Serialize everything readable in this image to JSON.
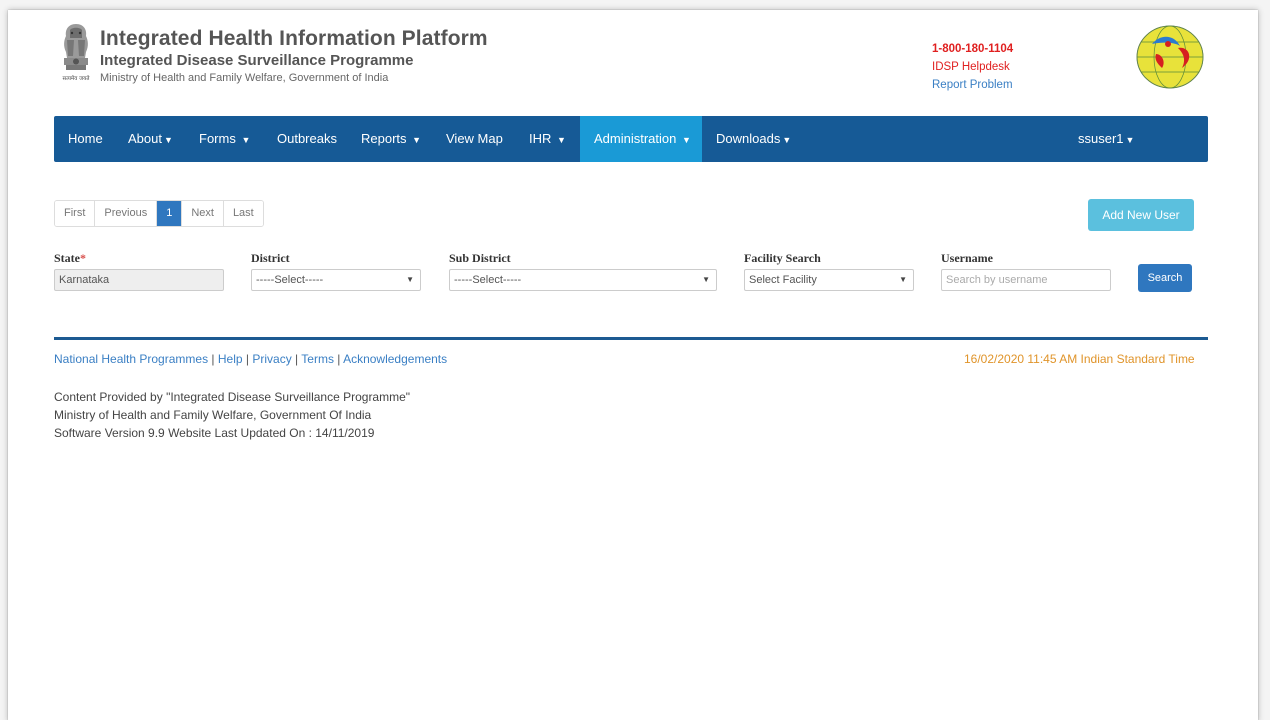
{
  "header": {
    "title": "Integrated Health Information Platform",
    "subtitle": "Integrated Disease Surveillance Programme",
    "ministry": "Ministry of Health and Family Welfare, Government of India",
    "emblem_caption": "सत्यमेव जयते",
    "phone": "1-800-180-1104",
    "helpdesk": "IDSP Helpdesk",
    "report_problem": "Report Problem"
  },
  "nav": {
    "home": "Home",
    "about": "About",
    "forms": "Forms",
    "outbreaks": "Outbreaks",
    "reports": "Reports",
    "view_map": "View Map",
    "ihr": "IHR",
    "administration": "Administration",
    "downloads": "Downloads",
    "user": "ssuser1"
  },
  "pager": {
    "first": "First",
    "previous": "Previous",
    "current": "1",
    "next": "Next",
    "last": "Last"
  },
  "add_user_label": "Add New User",
  "filters": {
    "state_label": "State",
    "state_required": "*",
    "state_value": "Karnataka",
    "district_label": "District",
    "district_value": "-----Select-----",
    "subdistrict_label": "Sub District",
    "subdistrict_value": "-----Select-----",
    "facility_label": "Facility Search",
    "facility_value": "Select Facility",
    "username_label": "Username",
    "username_placeholder": "Search by username"
  },
  "search_label": "Search",
  "footer": {
    "links": {
      "nhp": "National Health Programmes",
      "help": "Help",
      "privacy": "Privacy",
      "terms": "Terms",
      "ack": "Acknowledgements"
    },
    "timestamp": "16/02/2020 11:45 AM Indian Standard Time",
    "credit_line1": "Content Provided by \"Integrated Disease Surveillance Programme\"",
    "credit_line2": "Ministry of Health and Family Welfare, Government Of India",
    "credit_line3": "Software Version 9.9  Website Last Updated On :  14/11/2019"
  },
  "colors": {
    "navbar": "#165a96",
    "nav_active": "#1a9ad6",
    "primary_button": "#2f77bf",
    "info_button": "#5bc0de",
    "helpline_red": "#e02020",
    "link_blue": "#3a7fc4",
    "timestamp_orange": "#e0942a"
  }
}
